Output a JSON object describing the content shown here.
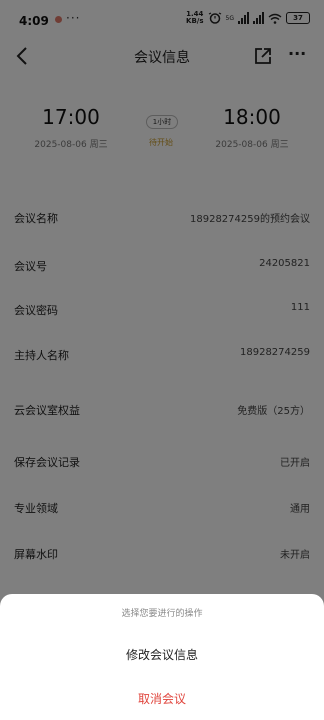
{
  "status_bar": {
    "time": "4:09",
    "more": "···",
    "net_speed_value": "1.44",
    "net_speed_unit": "KB/s",
    "signal_tag": "5G",
    "battery": "37"
  },
  "header": {
    "title": "会议信息"
  },
  "meeting": {
    "start_time": "17:00",
    "start_date": "2025-08-06 周三",
    "end_time": "18:00",
    "end_date": "2025-08-06 周三",
    "duration": "1小时",
    "status": "待开始"
  },
  "details": [
    {
      "label": "会议名称",
      "value": "18928274259的预约会议"
    },
    {
      "label": "会议号",
      "value": "24205821"
    },
    {
      "label": "会议密码",
      "value": "111"
    },
    {
      "label": "主持人名称",
      "value": "18928274259"
    },
    {
      "label": "云会议室权益",
      "value": "免费版（25方）"
    },
    {
      "label": "保存会议记录",
      "value": "已开启"
    },
    {
      "label": "专业领域",
      "value": "通用"
    },
    {
      "label": "屏幕水印",
      "value": "未开启"
    }
  ],
  "action_sheet": {
    "title": "选择您要进行的操作",
    "edit_label": "修改会议信息",
    "cancel_label": "取消会议"
  },
  "colors": {
    "cancel_red": "#e0463e",
    "status_gold": "#c79a2b",
    "overlay": "rgba(0,0,0,0.5)"
  }
}
